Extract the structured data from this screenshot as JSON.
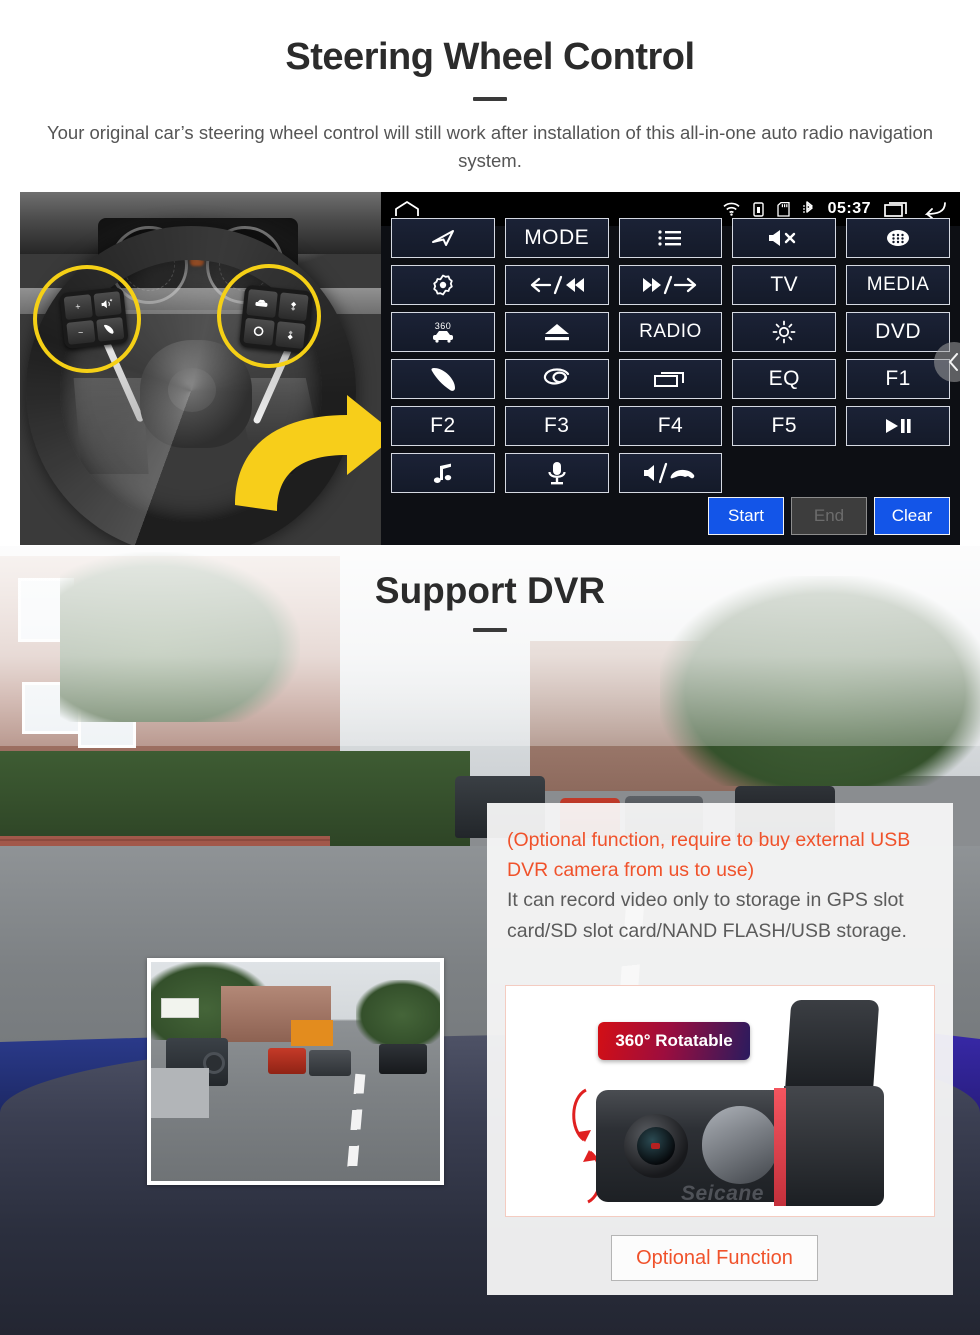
{
  "swc": {
    "title": "Steering Wheel Control",
    "description": "Your original car’s steering wheel control will still work after installation of this all-in-one auto radio navigation system."
  },
  "head_unit": {
    "status_bar": {
      "home_icon": "home-icon",
      "wifi_icon": "wifi-icon",
      "battery_icon": "battery-lock-icon",
      "sdcard_icon": "sd-card-icon",
      "bluetooth_icon": "bluetooth-icon",
      "clock": "05:37",
      "recents_icon": "recents-icon",
      "back_icon": "back-icon"
    },
    "buttons": [
      {
        "id": "nav",
        "label": "",
        "icon": "navigation-arrow-icon"
      },
      {
        "id": "mode",
        "label": "MODE",
        "icon": ""
      },
      {
        "id": "list",
        "label": "",
        "icon": "list-icon"
      },
      {
        "id": "mute",
        "label": "",
        "icon": "mute-icon"
      },
      {
        "id": "apps",
        "label": "",
        "icon": "apps-grid-icon"
      },
      {
        "id": "setting",
        "label": "",
        "icon": "gear-dot-icon"
      },
      {
        "id": "prev",
        "label": "",
        "icon": "prev-track-icon"
      },
      {
        "id": "next",
        "label": "",
        "icon": "next-track-icon"
      },
      {
        "id": "tv",
        "label": "TV",
        "icon": ""
      },
      {
        "id": "media",
        "label": "MEDIA",
        "icon": ""
      },
      {
        "id": "cam360",
        "label": "",
        "icon": "360-car-icon"
      },
      {
        "id": "eject",
        "label": "",
        "icon": "eject-icon"
      },
      {
        "id": "radio",
        "label": "RADIO",
        "icon": ""
      },
      {
        "id": "brightness",
        "label": "",
        "icon": "brightness-icon"
      },
      {
        "id": "dvd",
        "label": "DVD",
        "icon": ""
      },
      {
        "id": "phone",
        "label": "",
        "icon": "phone-icon"
      },
      {
        "id": "swirl",
        "label": "",
        "icon": "swirl-icon"
      },
      {
        "id": "window",
        "label": "",
        "icon": "window-icon"
      },
      {
        "id": "eq",
        "label": "EQ",
        "icon": ""
      },
      {
        "id": "f1",
        "label": "F1",
        "icon": ""
      },
      {
        "id": "f2",
        "label": "F2",
        "icon": ""
      },
      {
        "id": "f3",
        "label": "F3",
        "icon": ""
      },
      {
        "id": "f4",
        "label": "F4",
        "icon": ""
      },
      {
        "id": "f5",
        "label": "F5",
        "icon": ""
      },
      {
        "id": "playpause",
        "label": "",
        "icon": "play-pause-icon"
      },
      {
        "id": "music",
        "label": "",
        "icon": "music-note-icon"
      },
      {
        "id": "mic",
        "label": "",
        "icon": "microphone-icon"
      },
      {
        "id": "volhangup",
        "label": "",
        "icon": "volume-hangup-icon"
      },
      {
        "id": "blank1",
        "label": "",
        "icon": ""
      },
      {
        "id": "blank2",
        "label": "",
        "icon": ""
      }
    ],
    "actions": [
      {
        "id": "start",
        "label": "Start",
        "state": "enabled"
      },
      {
        "id": "end",
        "label": "End",
        "state": "disabled"
      },
      {
        "id": "clear",
        "label": "Clear",
        "state": "enabled"
      }
    ],
    "scroll_prev_icon": "chevron-left-icon"
  },
  "dvr": {
    "title": "Support DVR",
    "note_orange": "(Optional function, require to buy external USB DVR camera from us to use)",
    "note_grey": "It can record video only to storage in GPS slot card/SD slot card/NAND FLASH/USB storage.",
    "badge": "360° Rotatable",
    "camera_brand": "Seicane",
    "optional_button": "Optional Function"
  },
  "colors": {
    "accent_orange": "#f0522b",
    "primary_blue": "#1355e8",
    "highlight_yellow": "#f5d016",
    "badge_red": "#d30f15",
    "badge_navy": "#2a1b5e",
    "panel_navy": "#1b2236"
  }
}
